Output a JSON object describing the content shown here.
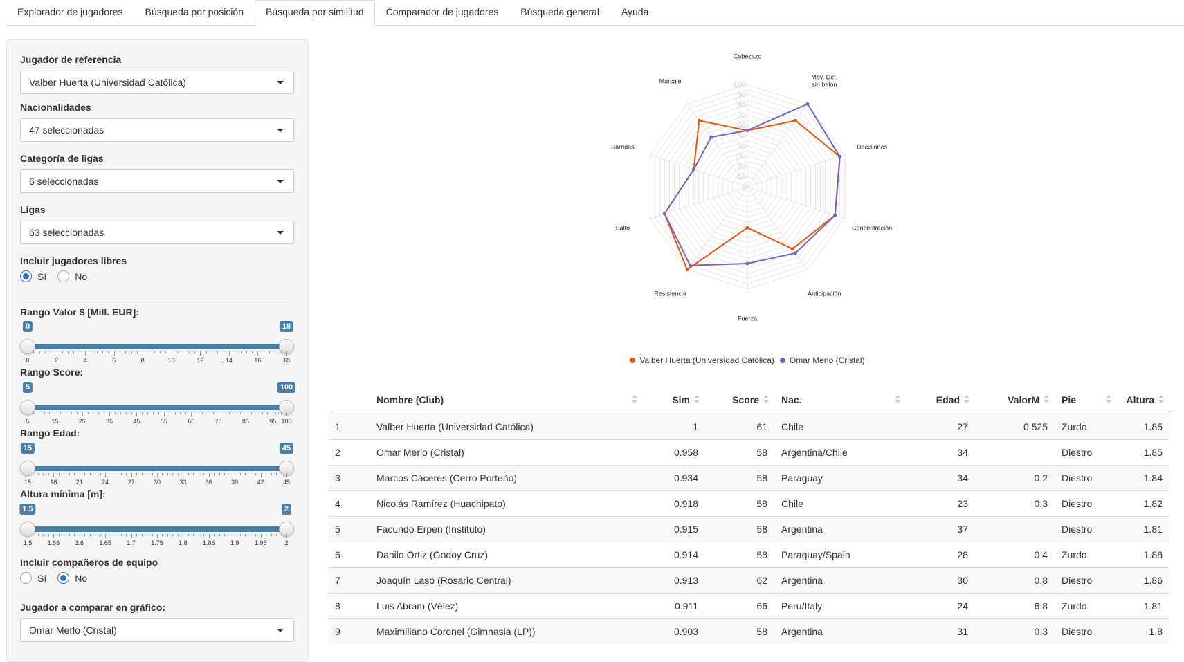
{
  "tabs": [
    {
      "label": "Explorador de jugadores",
      "active": false
    },
    {
      "label": "Búsqueda por posición",
      "active": false
    },
    {
      "label": "Búsqueda por similitud",
      "active": true
    },
    {
      "label": "Comparador de jugadores",
      "active": false
    },
    {
      "label": "Búsqueda general",
      "active": false
    },
    {
      "label": "Ayuda",
      "active": false
    }
  ],
  "sidebar": {
    "ref_player_label": "Jugador de referencia",
    "ref_player_value": "Valber Huerta (Universidad Católica)",
    "nationalities_label": "Nacionalidades",
    "nationalities_value": "47 seleccionadas",
    "league_cat_label": "Categoría de ligas",
    "league_cat_value": "6 seleccionadas",
    "leagues_label": "Ligas",
    "leagues_value": "63 seleccionadas",
    "free_label": "Incluir jugadores libres",
    "free_yes": "Sí",
    "free_no": "No",
    "free_selected": "Sí",
    "value_range_label": "Rango Valor $ [Mill. EUR]:",
    "score_range_label": "Rango Score:",
    "age_range_label": "Rango Edad:",
    "height_min_label": "Altura mínima [m]:",
    "teammates_label": "Incluir compañeros de equipo",
    "teammates_yes": "Sí",
    "teammates_no": "No",
    "teammates_selected": "No",
    "compare_label": "Jugador a comparar en gráfico:",
    "compare_value": "Omar Merlo (Cristal)"
  },
  "sliders": [
    {
      "id": "valor",
      "min": 0,
      "max": 18,
      "from": 0,
      "to": 18,
      "labels": [
        "0",
        "2",
        "4",
        "6",
        "8",
        "10",
        "12",
        "14",
        "16",
        "18"
      ]
    },
    {
      "id": "score",
      "min": 5,
      "max": 100,
      "from": 5,
      "to": 100,
      "labels": [
        "5",
        "15",
        "25",
        "35",
        "45",
        "55",
        "65",
        "75",
        "85",
        "95",
        "100"
      ]
    },
    {
      "id": "edad",
      "min": 15,
      "max": 45,
      "from": 15,
      "to": 45,
      "labels": [
        "15",
        "18",
        "21",
        "24",
        "27",
        "30",
        "33",
        "36",
        "39",
        "42",
        "45"
      ]
    },
    {
      "id": "altura",
      "min": 1.5,
      "max": 2,
      "from": 1.5,
      "to": 2,
      "labels": [
        "1.5",
        "1.55",
        "1.6",
        "1.65",
        "1.7",
        "1.75",
        "1.8",
        "1.85",
        "1.9",
        "1.95",
        "2"
      ]
    }
  ],
  "chart_data": {
    "type": "radar",
    "axes": [
      "Cabezazo",
      "Mov. Def. sin balón",
      "Decisiones",
      "Concentración",
      "Anticipación",
      "Fuerza",
      "Resistencia",
      "Salto",
      "Barridas",
      "Marcaje"
    ],
    "range": [
      0,
      100
    ],
    "ticks": [
      0,
      10,
      20,
      30,
      40,
      50,
      60,
      70,
      80,
      90,
      100
    ],
    "series": [
      {
        "name": "Valber Huerta (Universidad Católica)",
        "color": "#e4570f",
        "values": [
          55,
          80,
          95,
          90,
          75,
          40,
          100,
          85,
          55,
          80
        ]
      },
      {
        "name": "Omar Merlo (Cristal)",
        "color": "#7b62b8",
        "values": [
          55,
          100,
          95,
          90,
          80,
          75,
          95,
          85,
          55,
          60
        ]
      }
    ]
  },
  "table": {
    "columns": [
      "",
      "Nombre (Club)",
      "Sim",
      "Score",
      "Nac.",
      "Edad",
      "ValorM",
      "Pie",
      "Altura"
    ],
    "rows": [
      [
        "1",
        "Valber Huerta (Universidad Católica)",
        "1",
        "61",
        "Chile",
        "27",
        "0.525",
        "Zurdo",
        "1.85"
      ],
      [
        "2",
        "Omar Merlo (Cristal)",
        "0.958",
        "58",
        "Argentina/Chile",
        "34",
        "",
        "Diestro",
        "1.85"
      ],
      [
        "3",
        "Marcos Cáceres (Cerro Porteño)",
        "0.934",
        "58",
        "Paraguay",
        "34",
        "0.2",
        "Diestro",
        "1.84"
      ],
      [
        "4",
        "Nicolás Ramírez (Huachipato)",
        "0.918",
        "58",
        "Chile",
        "23",
        "0.3",
        "Diestro",
        "1.82"
      ],
      [
        "5",
        "Facundo Erpen (Instituto)",
        "0.915",
        "58",
        "Argentina",
        "37",
        "",
        "Diestro",
        "1.81"
      ],
      [
        "6",
        "Danilo Ortiz (Godoy Cruz)",
        "0.914",
        "58",
        "Paraguay/Spain",
        "28",
        "0.4",
        "Zurdo",
        "1.88"
      ],
      [
        "7",
        "Joaquín Laso (Rosario Central)",
        "0.913",
        "62",
        "Argentina",
        "30",
        "0.8",
        "Diestro",
        "1.86"
      ],
      [
        "8",
        "Luis Abram (Vélez)",
        "0.911",
        "66",
        "Peru/Italy",
        "24",
        "6.8",
        "Zurdo",
        "1.81"
      ],
      [
        "9",
        "Maximiliano Coronel (Gimnasia (LP))",
        "0.903",
        "58",
        "Argentina",
        "31",
        "0.3",
        "Diestro",
        "1.8"
      ]
    ]
  }
}
